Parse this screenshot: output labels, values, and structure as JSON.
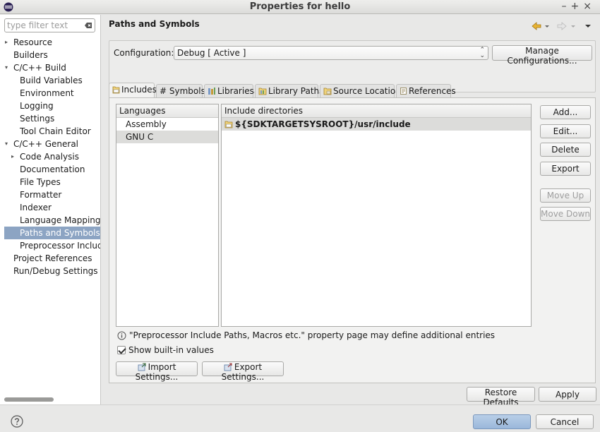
{
  "window": {
    "title": "Properties for hello",
    "controls": "←  +  ×"
  },
  "filter": {
    "placeholder": "type filter text"
  },
  "tree": [
    {
      "label": "Resource",
      "arrow": "▸"
    },
    {
      "label": "Builders",
      "arrow": ""
    },
    {
      "label": "C/C++ Build",
      "arrow": "▾"
    },
    {
      "label": "Build Variables",
      "arrow": ""
    },
    {
      "label": "Environment",
      "arrow": ""
    },
    {
      "label": "Logging",
      "arrow": ""
    },
    {
      "label": "Settings",
      "arrow": ""
    },
    {
      "label": "Tool Chain Editor",
      "arrow": ""
    },
    {
      "label": "C/C++ General",
      "arrow": "▾"
    },
    {
      "label": "Code Analysis",
      "arrow": "▸"
    },
    {
      "label": "Documentation",
      "arrow": ""
    },
    {
      "label": "File Types",
      "arrow": ""
    },
    {
      "label": "Formatter",
      "arrow": ""
    },
    {
      "label": "Indexer",
      "arrow": ""
    },
    {
      "label": "Language Mappings",
      "arrow": ""
    },
    {
      "label": "Paths and Symbols",
      "arrow": ""
    },
    {
      "label": "Preprocessor Include",
      "arrow": ""
    },
    {
      "label": "Project References",
      "arrow": ""
    },
    {
      "label": "Run/Debug Settings",
      "arrow": ""
    }
  ],
  "page": {
    "title": "Paths and Symbols"
  },
  "config": {
    "label": "Configuration:",
    "value": "Debug  [ Active ]",
    "manage_label": "Manage Configurations..."
  },
  "tabs": [
    {
      "label": "Includes"
    },
    {
      "label": "# Symbols"
    },
    {
      "label": "Libraries"
    },
    {
      "label": "Library Paths"
    },
    {
      "label": "Source Location"
    },
    {
      "label": "References"
    }
  ],
  "languages": {
    "header": "Languages",
    "items": [
      "Assembly",
      "GNU C"
    ]
  },
  "includes": {
    "header": "Include directories",
    "items": [
      "${SDKTARGETSYSROOT}/usr/include"
    ]
  },
  "side_buttons": {
    "add": "Add...",
    "edit": "Edit...",
    "delete": "Delete",
    "export": "Export",
    "move_up": "Move Up",
    "move_down": "Move Down"
  },
  "info_text": "\"Preprocessor Include Paths, Macros etc.\" property page may define additional entries",
  "show_builtin": "Show built-in values",
  "import_label": "Import Settings...",
  "export_label": "Export Settings...",
  "restore_label": "Restore Defaults",
  "apply_label": "Apply",
  "ok_label": "OK",
  "cancel_label": "Cancel",
  "colors": {
    "selection": "#8ca4c3",
    "ok_button": "#a9c2e0"
  }
}
